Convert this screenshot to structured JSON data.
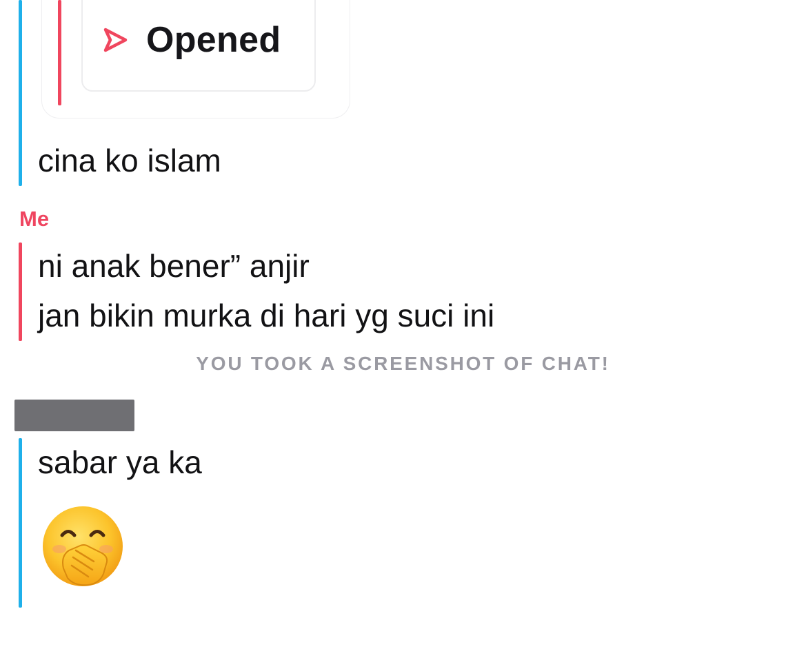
{
  "colors": {
    "friend_accent": "#1fb0ea",
    "me_accent": "#f0465e",
    "sender_me": "#ef4560",
    "system_text": "#9a9aa2"
  },
  "quoted_snap": {
    "icon": "opened-arrow-icon",
    "status": "Opened"
  },
  "messages": {
    "friend_1": "cina ko islam",
    "me_sender": "Me",
    "me_1": "ni anak bener” anjir",
    "me_2": "jan bikin murka di hari yg suci ini",
    "system_notice": "YOU TOOK A SCREENSHOT OF CHAT!",
    "friend_2": "sabar ya ka",
    "friend_2_emoji": "face-with-hand-over-mouth-icon"
  }
}
